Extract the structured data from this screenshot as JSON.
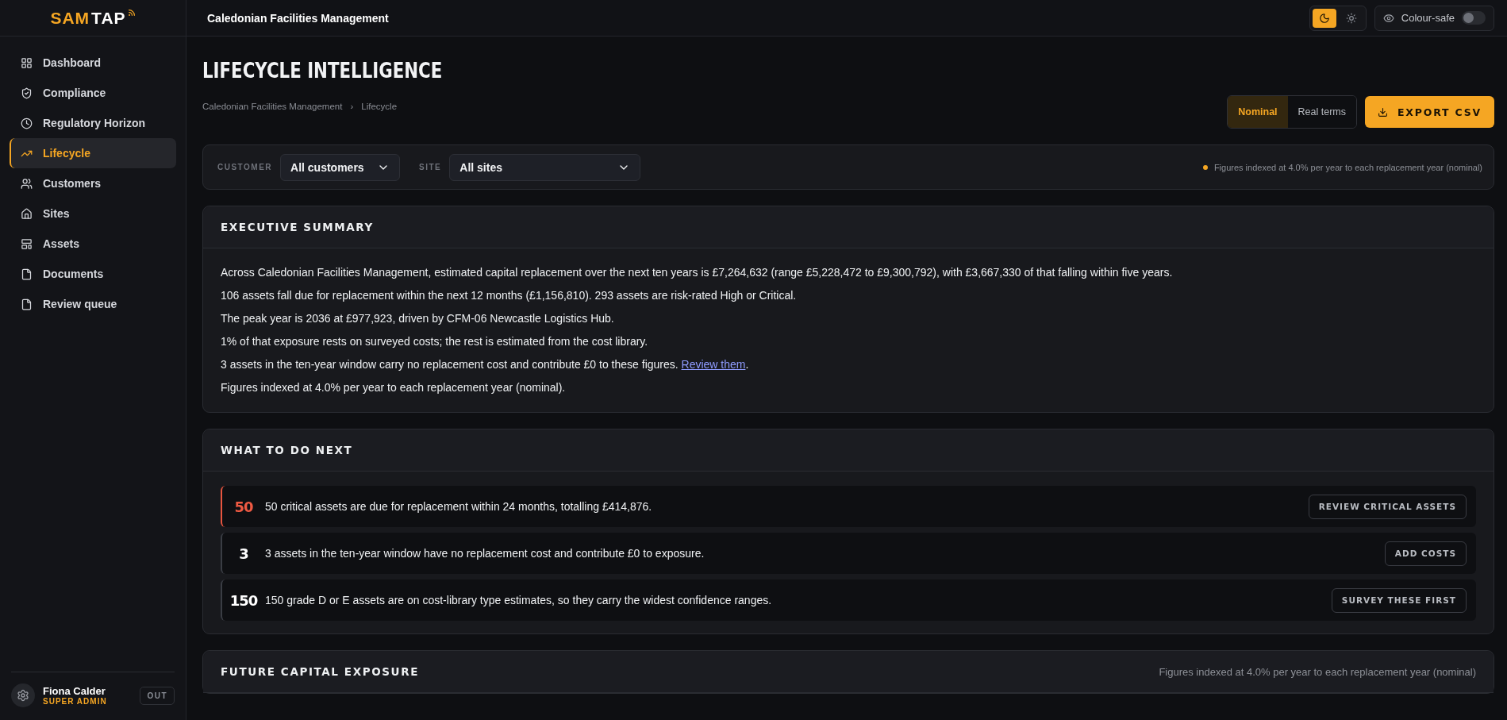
{
  "brand": {
    "first": "SAM",
    "second": "TAP"
  },
  "topbar": {
    "title": "Caledonian Facilities Management",
    "theme": [
      {
        "kind": "dark",
        "selected": true
      },
      {
        "kind": "light",
        "selected": false
      }
    ],
    "colour_safe": {
      "label": "Colour-safe",
      "on": false
    }
  },
  "sidebar": {
    "items": [
      {
        "label": "Dashboard",
        "selected": false
      },
      {
        "label": "Compliance",
        "selected": false
      },
      {
        "label": "Regulatory Horizon",
        "selected": false
      },
      {
        "label": "Lifecycle",
        "selected": true
      },
      {
        "label": "Customers",
        "selected": false
      },
      {
        "label": "Sites",
        "selected": false
      },
      {
        "label": "Assets",
        "selected": false
      },
      {
        "label": "Documents",
        "selected": false
      },
      {
        "label": "Review queue",
        "selected": false
      }
    ],
    "user": {
      "name": "Fiona Calder",
      "role": "SUPER ADMIN",
      "logout": "OUT"
    }
  },
  "page": {
    "title": "LIFECYCLE INTELLIGENCE",
    "breadcrumb": [
      "Caledonian Facilities Management",
      "Lifecycle"
    ],
    "separator": "›",
    "modes": [
      {
        "label": "Nominal",
        "selected": true
      },
      {
        "label": "Real terms",
        "selected": false
      }
    ],
    "export": "EXPORT CSV"
  },
  "filters": {
    "fields": [
      {
        "label": "CUSTOMER",
        "value": "All customers"
      },
      {
        "label": "SITE",
        "value": "All sites"
      }
    ],
    "note": "Figures indexed at 4.0% per year to each replacement year (nominal)"
  },
  "summary": {
    "title": "EXECUTIVE SUMMARY",
    "paragraphs": [
      {
        "text": "Across Caledonian Facilities Management, estimated capital replacement over the next ten years is £7,264,632 (range £5,228,472 to £9,300,792), with £3,667,330 of that falling within five years."
      },
      {
        "text": "106 assets fall due for replacement within the next 12 months (£1,156,810). 293 assets are risk-rated High or Critical."
      },
      {
        "text": "The peak year is 2036 at £977,923, driven by CFM-06 Newcastle Logistics Hub."
      },
      {
        "text": "1% of that exposure rests on surveyed costs; the rest is estimated from the cost library."
      },
      {
        "text": "3 assets in the ten-year window carry no replacement cost and contribute £0 to these figures. ",
        "link": "Review them",
        "after": "."
      },
      {
        "text": "Figures indexed at 4.0% per year to each replacement year (nominal)."
      }
    ]
  },
  "next": {
    "title": "WHAT TO DO NEXT",
    "actions": [
      {
        "kind": "critical",
        "count": "50",
        "text": "50 critical assets are due for replacement within 24 months, totalling £414,876.",
        "button": "REVIEW CRITICAL ASSETS"
      },
      {
        "kind": "normal",
        "count": "3",
        "text": "3 assets in the ten-year window have no replacement cost and contribute £0 to exposure.",
        "button": "ADD COSTS"
      },
      {
        "kind": "normal",
        "count": "150",
        "text": "150 grade D or E assets are on cost-library type estimates, so they carry the widest confidence ranges.",
        "button": "SURVEY THESE FIRST"
      }
    ]
  },
  "exposure": {
    "title": "FUTURE CAPITAL EXPOSURE",
    "note": "Figures indexed at 4.0% per year to each replacement year (nominal)"
  }
}
